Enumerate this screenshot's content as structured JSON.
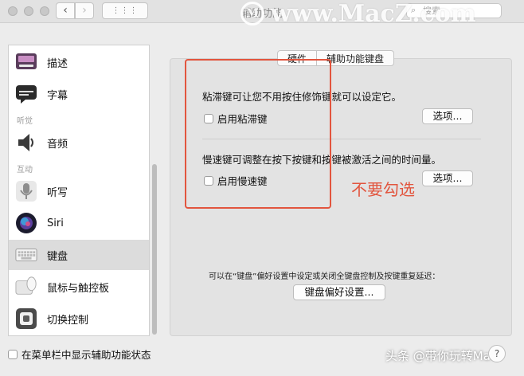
{
  "window": {
    "title": "辅助功能"
  },
  "search": {
    "placeholder": "搜索",
    "icon": "magnifier-icon"
  },
  "watermark": {
    "text": "www.MacZ.com",
    "logo_letter": "M"
  },
  "sidebar": {
    "items": [
      {
        "label": "描述",
        "icon": "description-icon"
      },
      {
        "label": "字幕",
        "icon": "captions-icon"
      },
      {
        "header": "听觉"
      },
      {
        "label": "音频",
        "icon": "speaker-icon"
      },
      {
        "header": "互动"
      },
      {
        "label": "听写",
        "icon": "microphone-icon"
      },
      {
        "label": "Siri",
        "icon": "siri-icon"
      },
      {
        "label": "键盘",
        "icon": "keyboard-icon",
        "selected": true
      },
      {
        "label": "鼠标与触控板",
        "icon": "mouse-trackpad-icon"
      },
      {
        "label": "切换控制",
        "icon": "switch-control-icon"
      }
    ]
  },
  "tabs": [
    {
      "label": "硬件"
    },
    {
      "label": "辅助功能键盘",
      "selected": true
    }
  ],
  "sticky_keys": {
    "description": "粘滞键可让您不用按住修饰键就可以设定它。",
    "checkbox_label": "启用粘滞键",
    "checked": false,
    "options_button": "选项..."
  },
  "slow_keys": {
    "description": "慢速键可调整在按下按键和按键被激活之间的时间量。",
    "checkbox_label": "启用慢速键",
    "checked": false,
    "options_button": "选项..."
  },
  "footer": {
    "note": "可以在“键盘”偏好设置中设定或关闭全键盘控制及按键重复延迟：",
    "button": "键盘偏好设置..."
  },
  "menubar_checkbox": {
    "label": "在菜单栏中显示辅助功能状态",
    "checked": false
  },
  "annotation": {
    "text": "不要勾选",
    "color": "#e2553e"
  },
  "credit": {
    "text": "头条 @带你玩转Mac"
  },
  "help": {
    "label": "?"
  }
}
